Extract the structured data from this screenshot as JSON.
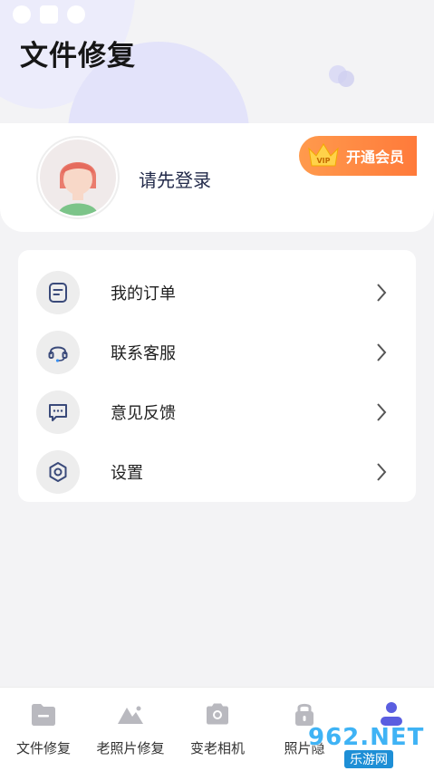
{
  "header": {
    "title": "文件修复"
  },
  "profile": {
    "login_prompt": "请先登录",
    "vip_label": "开通会员",
    "vip_badge_text": "VIP"
  },
  "menu": {
    "items": [
      {
        "label": "我的订单",
        "icon": "order-list-icon"
      },
      {
        "label": "联系客服",
        "icon": "headset-icon"
      },
      {
        "label": "意见反馈",
        "icon": "chat-bubble-icon"
      },
      {
        "label": "设置",
        "icon": "gear-icon"
      }
    ]
  },
  "nav": {
    "items": [
      {
        "label": "文件修复",
        "icon": "folder-icon"
      },
      {
        "label": "老照片修复",
        "icon": "mountain-photo-icon"
      },
      {
        "label": "变老相机",
        "icon": "camera-icon"
      },
      {
        "label": "照片隐",
        "icon": "lock-icon"
      },
      {
        "label": "",
        "icon": "user-icon"
      }
    ],
    "active_index": 4
  },
  "watermark": {
    "top": "962.NET",
    "bottom": "乐游网"
  },
  "colors": {
    "accent": "#5a5ee0",
    "vip_orange": "#ff8a40",
    "background": "#f3f3f5"
  }
}
